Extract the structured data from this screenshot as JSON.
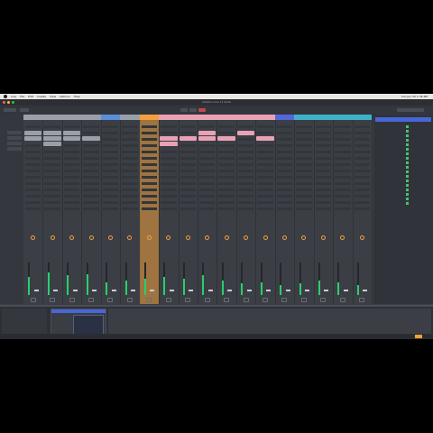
{
  "menubar": {
    "app_items": [
      "Live",
      "File",
      "Edit",
      "Create",
      "View",
      "Options",
      "Help"
    ],
    "clock": "Sun Jun 22 1:36 PM"
  },
  "window": {
    "title": "Ableton Live 11 Suite"
  },
  "colors": {
    "accent_orange": "#f2a03c",
    "browser_blue": "#4766d8",
    "meter_green": "#27d06a",
    "clip_pink": "#e9a1b4"
  },
  "tracks": [
    {
      "name": "",
      "color": "#9aa0a8",
      "clips": [
        18,
        24
      ],
      "level": 0.55
    },
    {
      "name": "",
      "color": "#9aa0a8",
      "clips": [
        18,
        24,
        30
      ],
      "level": 0.7
    },
    {
      "name": "",
      "color": "#9aa0a8",
      "clips": [
        18,
        24
      ],
      "level": 0.6
    },
    {
      "name": "",
      "color": "#9aa0a8",
      "clips": [
        24
      ],
      "level": 0.65
    },
    {
      "name": "",
      "color": "#5b8fd6",
      "clips": [],
      "level": 0.4
    },
    {
      "name": "",
      "color": "#9aa0a8",
      "clips": [],
      "level": 0.45
    },
    {
      "name": "",
      "color": "#f2a03c",
      "clips": [],
      "level": 0.5,
      "selected": true
    },
    {
      "name": "",
      "color": "#e9a1b4",
      "clips": [
        24,
        30
      ],
      "level": 0.55
    },
    {
      "name": "",
      "color": "#e9a1b4",
      "clips": [
        24
      ],
      "level": 0.5
    },
    {
      "name": "",
      "color": "#e9a1b4",
      "clips": [
        18,
        24
      ],
      "level": 0.6
    },
    {
      "name": "",
      "color": "#e9a1b4",
      "clips": [
        24
      ],
      "level": 0.45
    },
    {
      "name": "",
      "color": "#e9a1b4",
      "clips": [
        18
      ],
      "level": 0.35
    },
    {
      "name": "",
      "color": "#e9a1b4",
      "clips": [
        24
      ],
      "level": 0.4
    },
    {
      "name": "",
      "color": "#5566d8",
      "clips": [],
      "level": 0.3
    },
    {
      "name": "",
      "color": "#3fb0c8",
      "clips": [],
      "level": 0.35
    },
    {
      "name": "",
      "color": "#3fb0c8",
      "clips": [],
      "level": 0.45
    },
    {
      "name": "",
      "color": "#3fb0c8",
      "clips": [],
      "level": 0.4
    },
    {
      "name": "",
      "color": "#3fb0c8",
      "clips": [],
      "level": 0.3
    }
  ],
  "browser": {
    "header": "",
    "items": [
      {
        "text": "",
        "highlight": true
      },
      {
        "text": "",
        "highlight": true
      },
      {
        "text": "",
        "highlight": true
      },
      {
        "text": "",
        "highlight": true
      },
      {
        "text": "",
        "highlight": true
      },
      {
        "text": "",
        "highlight": true
      },
      {
        "text": "",
        "highlight": false
      },
      {
        "text": "",
        "highlight": false
      },
      {
        "text": "",
        "highlight": true
      },
      {
        "text": "",
        "highlight": true
      },
      {
        "text": "",
        "highlight": true
      },
      {
        "text": "",
        "highlight": true
      },
      {
        "text": "",
        "highlight": false
      },
      {
        "text": "",
        "highlight": false
      },
      {
        "text": "",
        "highlight": false
      },
      {
        "text": "",
        "highlight": false
      },
      {
        "text": "",
        "highlight": false
      },
      {
        "text": "",
        "highlight": false
      }
    ]
  },
  "info_view": {
    "title": "",
    "body": ""
  },
  "device": {
    "title": ""
  },
  "dropzone": {
    "text": ""
  }
}
